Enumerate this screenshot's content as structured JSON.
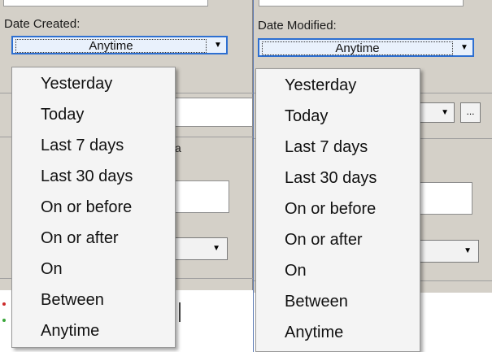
{
  "date_created": {
    "label": "Date Created:",
    "selected_value": "Anytime",
    "options": [
      "Yesterday",
      "Today",
      "Last 7 days",
      "Last 30 days",
      "On or before",
      "On or after",
      "On",
      "Between",
      "Anytime"
    ]
  },
  "date_modified": {
    "label": "Date Modified:",
    "selected_value": "Anytime",
    "options": [
      "Yesterday",
      "Today",
      "Last 7 days",
      "Last 30 days",
      "On or before",
      "On or after",
      "On",
      "Between",
      "Anytime"
    ]
  },
  "background": {
    "partial_label_fragment": "a",
    "ellipsis_button_label": "...",
    "dropdown_arrow_icon": "chevron-down-icon"
  },
  "colors": {
    "panel_bg": "#d4d0c8",
    "combo_focus_border": "#2d6fd1",
    "menu_bg": "#f4f4f4"
  }
}
